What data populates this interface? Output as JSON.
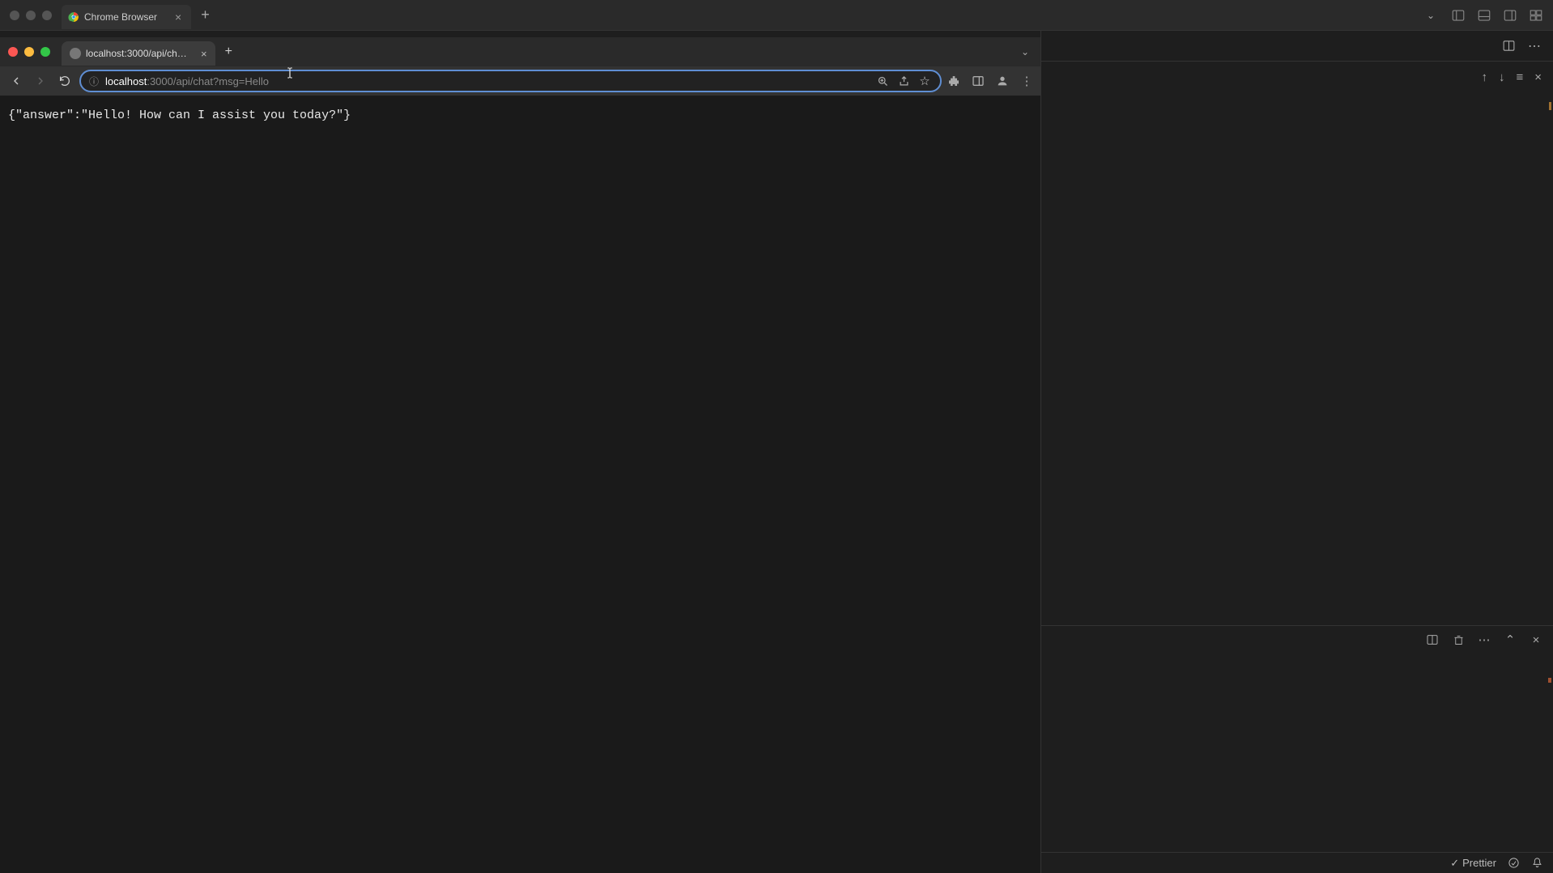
{
  "outer": {
    "tab_title": "Chrome Browser"
  },
  "chrome": {
    "tab_full": "localhost:3000/api/chat?msg=",
    "url_host": "localhost",
    "url_rest": ":3000/api/chat?msg=Hello"
  },
  "page": {
    "body": "{\"answer\":\"Hello! How can I assist you today?\"}"
  },
  "status": {
    "prettier": "Prettier"
  }
}
